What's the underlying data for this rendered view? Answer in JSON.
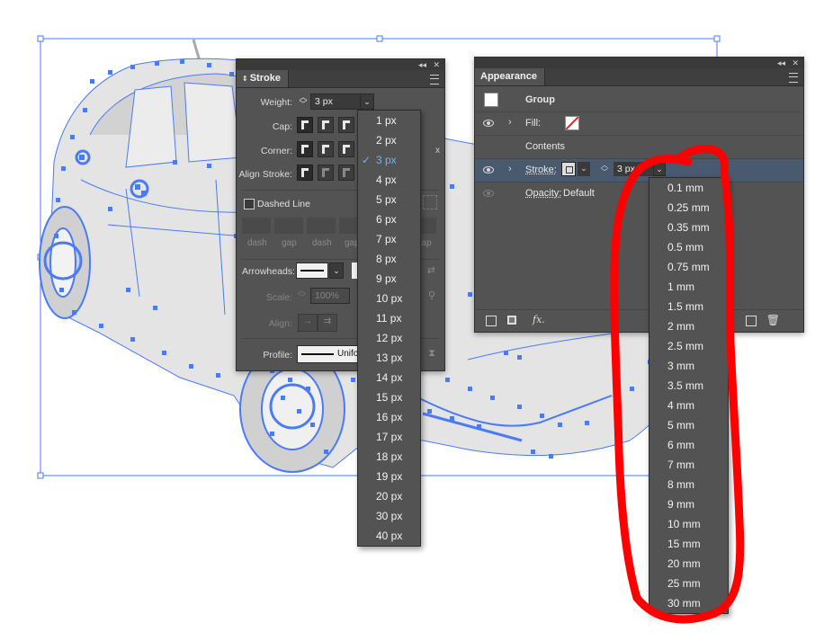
{
  "stroke_panel": {
    "tab": "Stroke",
    "weight_label": "Weight:",
    "weight_value": "3 px",
    "cap_label": "Cap:",
    "corner_label": "Corner:",
    "align_stroke_label": "Align Stroke:",
    "dashed_line_label": "Dashed Line",
    "dash_labels": [
      "dash",
      "gap",
      "dash",
      "gap",
      "dash",
      "gap"
    ],
    "arrowheads_label": "Arrowheads:",
    "scale_label": "Scale:",
    "scale_value": "100%",
    "align_label": "Align:",
    "profile_label": "Profile:",
    "profile_value": "Uniform"
  },
  "weight_menu": {
    "items": [
      "1 px",
      "2 px",
      "3 px",
      "4 px",
      "5 px",
      "6 px",
      "7 px",
      "8 px",
      "9 px",
      "10 px",
      "11 px",
      "12 px",
      "13 px",
      "14 px",
      "15 px",
      "16 px",
      "17 px",
      "18 px",
      "19 px",
      "20 px",
      "30 px",
      "40 px"
    ],
    "selected": "3 px",
    "check": "✓"
  },
  "appearance_panel": {
    "tab": "Appearance",
    "group_label": "Group",
    "fill_label": "Fill:",
    "contents_label": "Contents",
    "stroke_label": "Stroke:",
    "stroke_value": "3 px",
    "opacity_label": "Opacity:",
    "opacity_value": "Default",
    "fx_label": "fx."
  },
  "stroke_units_menu": {
    "items": [
      "0.1 mm",
      "0.25 mm",
      "0.35 mm",
      "0.5 mm",
      "0.75 mm",
      "1 mm",
      "1.5 mm",
      "2 mm",
      "2.5 mm",
      "3 mm",
      "3.5 mm",
      "4 mm",
      "5 mm",
      "6 mm",
      "7 mm",
      "8 mm",
      "9 mm",
      "10 mm",
      "15 mm",
      "20 mm",
      "25 mm",
      "30 mm"
    ]
  },
  "colors": {
    "panel_bg": "#535353",
    "panel_header": "#3f3f3f",
    "selection_blue": "#4a7bf4",
    "artwork_fill": "#e3e3e3",
    "annotation_red": "#ff0000",
    "selected_item": "#6fb2f5"
  }
}
